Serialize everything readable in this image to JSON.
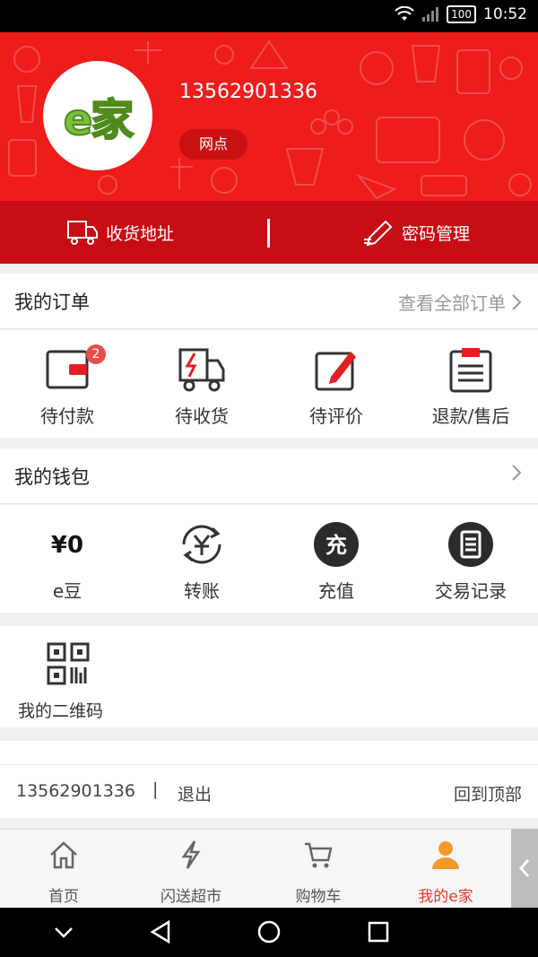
{
  "statusbar": {
    "battery": "100",
    "time": "10:52"
  },
  "profile": {
    "logo_text": "e家",
    "phone": "13562901336",
    "tag": "网点"
  },
  "shortcuts": {
    "address_label": "收货地址",
    "password_label": "密码管理"
  },
  "orders": {
    "title": "我的订单",
    "more": "查看全部订单",
    "items": [
      {
        "label": "待付款",
        "icon": "wallet-icon",
        "badge": "2"
      },
      {
        "label": "待收货",
        "icon": "delivery-truck-icon"
      },
      {
        "label": "待评价",
        "icon": "review-pen-icon"
      },
      {
        "label": "退款/售后",
        "icon": "clipboard-icon"
      }
    ]
  },
  "wallet": {
    "title": "我的钱包",
    "items": [
      {
        "value": "¥0",
        "label": "e豆"
      },
      {
        "label": "转账",
        "icon": "transfer-yen-icon"
      },
      {
        "label": "充值",
        "icon": "recharge-icon",
        "icon_text": "充"
      },
      {
        "label": "交易记录",
        "icon": "records-icon"
      }
    ]
  },
  "qr": {
    "label": "我的二维码",
    "icon": "qr-code-icon"
  },
  "footer": {
    "phone": "13562901336",
    "sep": "|",
    "logout": "退出",
    "top": "回到顶部"
  },
  "tabs": [
    {
      "label": "首页",
      "icon": "home-icon"
    },
    {
      "label": "闪送超市",
      "icon": "lightning-icon"
    },
    {
      "label": "购物车",
      "icon": "cart-icon"
    },
    {
      "label": "我的e家",
      "icon": "person-icon",
      "active": true
    }
  ],
  "colors": {
    "brand_red": "#ef1c1c",
    "dark_red": "#c80c14",
    "active_tab": "#e53a2c",
    "tab_icon_active": "#f39a2b"
  }
}
